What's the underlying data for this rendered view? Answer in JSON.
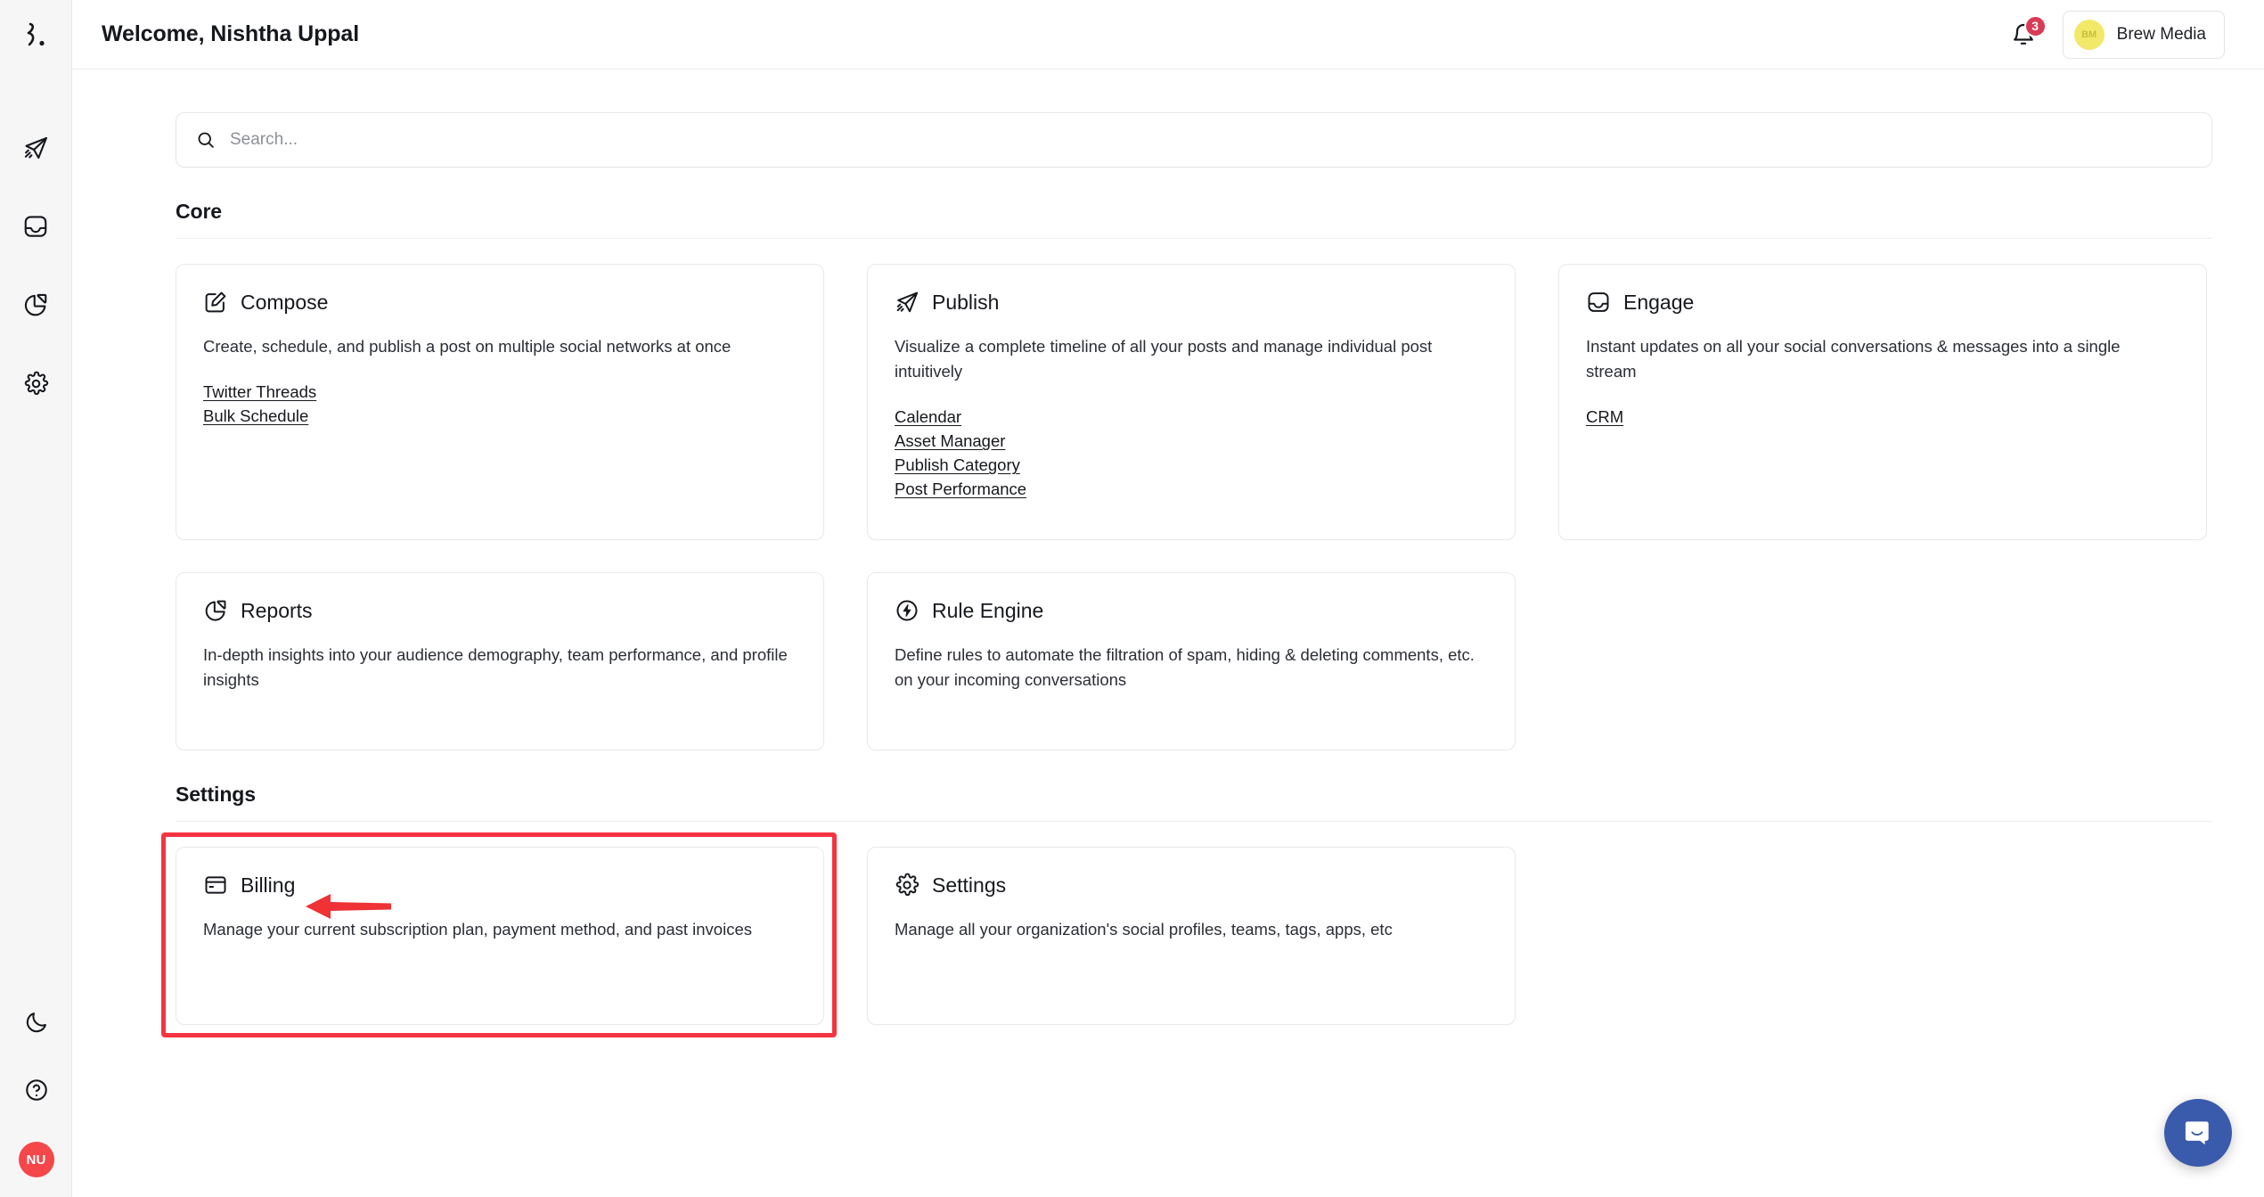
{
  "app": {
    "logo_icon": "brand-brace-dot-logo"
  },
  "sidebar": {
    "items": [
      {
        "name": "publish",
        "icon": "paper-plane-icon"
      },
      {
        "name": "inbox",
        "icon": "inbox-icon"
      },
      {
        "name": "reports",
        "icon": "pie-chart-icon"
      },
      {
        "name": "settings",
        "icon": "gear-icon"
      }
    ],
    "bottom": [
      {
        "name": "dark-mode",
        "icon": "moon-icon"
      },
      {
        "name": "help",
        "icon": "question-circle-icon"
      }
    ],
    "user_avatar_initials": "NU"
  },
  "header": {
    "greeting": "Welcome, Nishtha Uppal",
    "notifications": {
      "icon": "bell-icon",
      "count": "3"
    },
    "org": {
      "initials": "BM",
      "name": "Brew Media"
    }
  },
  "search": {
    "icon": "search-icon",
    "placeholder": "Search...",
    "value": ""
  },
  "sections": [
    {
      "id": "core",
      "title": "Core"
    },
    {
      "id": "settings",
      "title": "Settings"
    }
  ],
  "cards": {
    "compose": {
      "title": "Compose",
      "icon": "edit-square-icon",
      "desc": "Create, schedule, and publish a post on multiple social networks at once",
      "links": [
        "Twitter Threads",
        "Bulk Schedule"
      ]
    },
    "publish": {
      "title": "Publish",
      "icon": "paper-plane-icon",
      "desc": "Visualize a complete timeline of all your posts and manage individual post intuitively",
      "links": [
        "Calendar",
        "Asset Manager",
        "Publish Category",
        "Post Performance"
      ]
    },
    "engage": {
      "title": "Engage",
      "icon": "inbox-icon",
      "desc": "Instant updates on all your social conversations & messages into a single stream",
      "links": [
        "CRM"
      ]
    },
    "reports": {
      "title": "Reports",
      "icon": "pie-chart-icon",
      "desc": "In-depth insights into your audience demography, team performance, and profile insights",
      "links": []
    },
    "rule_engine": {
      "title": "Rule Engine",
      "icon": "bolt-circle-icon",
      "desc": "Define rules to automate the filtration of spam, hiding & deleting comments, etc. on your incoming conversations",
      "links": []
    },
    "billing": {
      "title": "Billing",
      "icon": "credit-card-icon",
      "desc": "Manage your current subscription plan, payment method, and past invoices",
      "links": []
    },
    "settings": {
      "title": "Settings",
      "icon": "gear-icon",
      "desc": "Manage all your organization's social profiles, teams, tags, apps, etc",
      "links": []
    }
  },
  "annotation": {
    "highlight_color": "#f5343f",
    "arrow_icon": "left-arrow-annotation",
    "target": "billing"
  },
  "chat": {
    "icon": "chat-bubble-icon",
    "color": "#3a5bab"
  },
  "colors": {
    "accent_red": "#f5464a",
    "badge_red": "#d93b56",
    "org_yellow": "#f2e96b",
    "sidebar_bg": "#f6f6f7",
    "page_bg": "#ffffff",
    "border": "#e9e9ec"
  }
}
